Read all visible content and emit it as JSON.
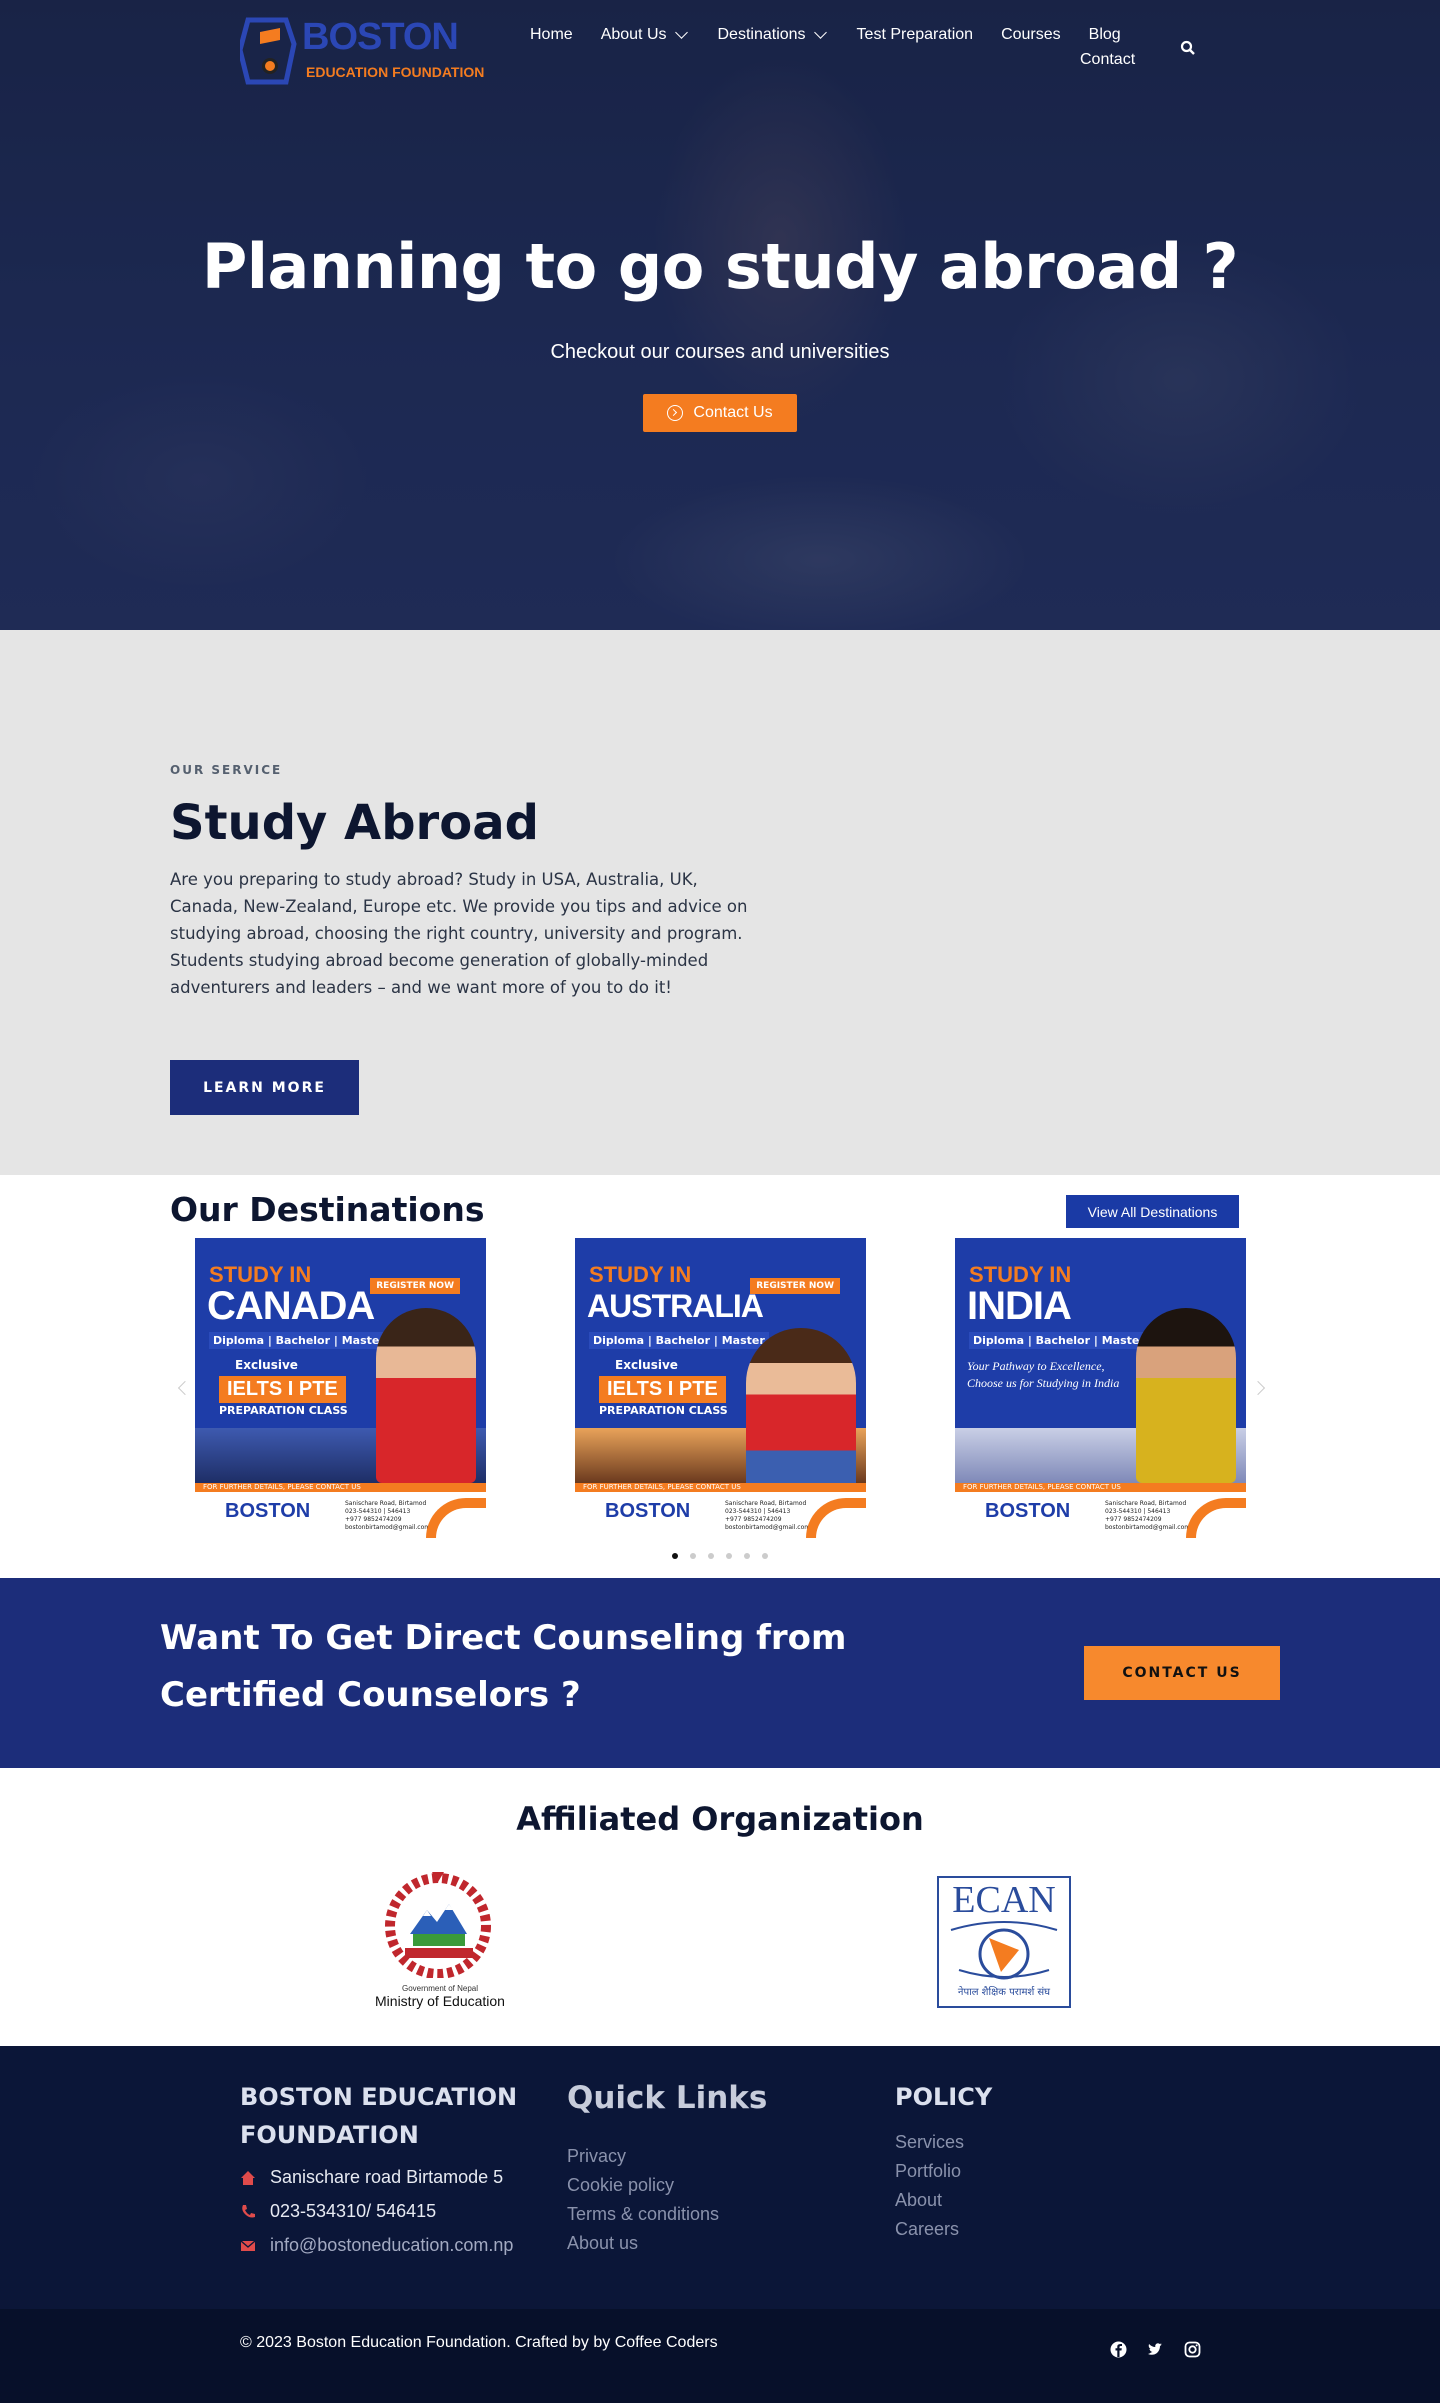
{
  "nav": {
    "logo_text": "BOSTON",
    "logo_sub": "EDUCATION FOUNDATION",
    "items": [
      "Home",
      "About Us",
      "Destinations",
      "Test Preparation",
      "Courses",
      "Blog"
    ],
    "contact": "Contact"
  },
  "hero": {
    "title": "Planning to go study abroad ?",
    "subtitle": "Checkout our courses and universities",
    "button": "Contact Us"
  },
  "service": {
    "eyebrow": "OUR SERVICE",
    "title": "Study Abroad",
    "text": "Are you preparing to study abroad? Study in USA, Australia, UK, Canada, New-Zealand, Europe etc. We provide you tips and advice on studying abroad, choosing the right country, university and program. Students studying abroad become generation of globally-minded adventurers and leaders – and we want more of you to do it!",
    "button": "LEARN MORE"
  },
  "destinations": {
    "title": "Our Destinations",
    "view_all": "View All Destinations",
    "cards": [
      {
        "study": "STUDY IN",
        "country": "CANADA",
        "levels": "Diploma | Bachelor | Master",
        "register": "REGISTER NOW",
        "exclusive": "Exclusive",
        "ielts": "IELTS I PTE",
        "prep": "PREPARATION CLASS",
        "strip": "FOR FURTHER DETAILS, PLEASE CONTACT US",
        "brand": "BOSTON",
        "address": "Sanischare Road, Birtamod",
        "phone": "023-544310 | 546413",
        "mobile": "+977 9852474209",
        "email": "bostonbirtamod@gmail.com"
      },
      {
        "study": "STUDY IN",
        "country": "AUSTRALIA",
        "levels": "Diploma | Bachelor | Master",
        "register": "REGISTER NOW",
        "exclusive": "Exclusive",
        "ielts": "IELTS I PTE",
        "prep": "PREPARATION CLASS",
        "strip": "FOR FURTHER DETAILS, PLEASE CONTACT US",
        "brand": "BOSTON",
        "address": "Sanischare Road, Birtamod",
        "phone": "023-544310 | 546413",
        "mobile": "+977 9852474209",
        "email": "bostonbirtamod@gmail.com"
      },
      {
        "study": "STUDY IN",
        "country": "INDIA",
        "levels": "Diploma | Bachelor | Master",
        "tagline": "Your Pathway to Excellence, Choose us for Studying in India",
        "strip": "FOR FURTHER DETAILS, PLEASE CONTACT US",
        "brand": "BOSTON",
        "address": "Sanischare Road, Birtamod",
        "phone": "023-544310 | 546413",
        "mobile": "+977 9852474209",
        "email": "bostonbirtamod@gmail.com"
      }
    ],
    "active_slide": 1,
    "slide_count": 6
  },
  "cta": {
    "title": "Want To Get Direct Counseling from Certified Counselors ?",
    "button": "CONTACT US"
  },
  "affiliated": {
    "title": "Affiliated Organization",
    "logo1_caption_small": "Government of Nepal",
    "logo1_caption": "Ministry of Education",
    "logo2_text": "ECAN",
    "logo2_caption": "नेपाल शैक्षिक परामर्श संघ"
  },
  "footer": {
    "org": "BOSTON EDUCATION FOUNDATION",
    "address": "Sanischare road Birtamode 5",
    "phone": "023-534310/ 546415",
    "email": "info@bostoneducation.com.np",
    "quick_links_title": "Quick Links",
    "quick_links": [
      "Privacy",
      "Cookie policy",
      "Terms & conditions",
      "About us"
    ],
    "policy_title": "POLICY",
    "policy_links": [
      "Services",
      "Portfolio",
      "About",
      "Careers"
    ],
    "copyright": "© 2023 Boston Education Foundation. Crafted by by Coffee Coders",
    "icon_color": "#e04b4b"
  },
  "colors": {
    "navy": "#1c2d7a",
    "orange": "#f47c20",
    "footer_bg": "#0b1638",
    "service_bg": "#e5e5e5"
  }
}
